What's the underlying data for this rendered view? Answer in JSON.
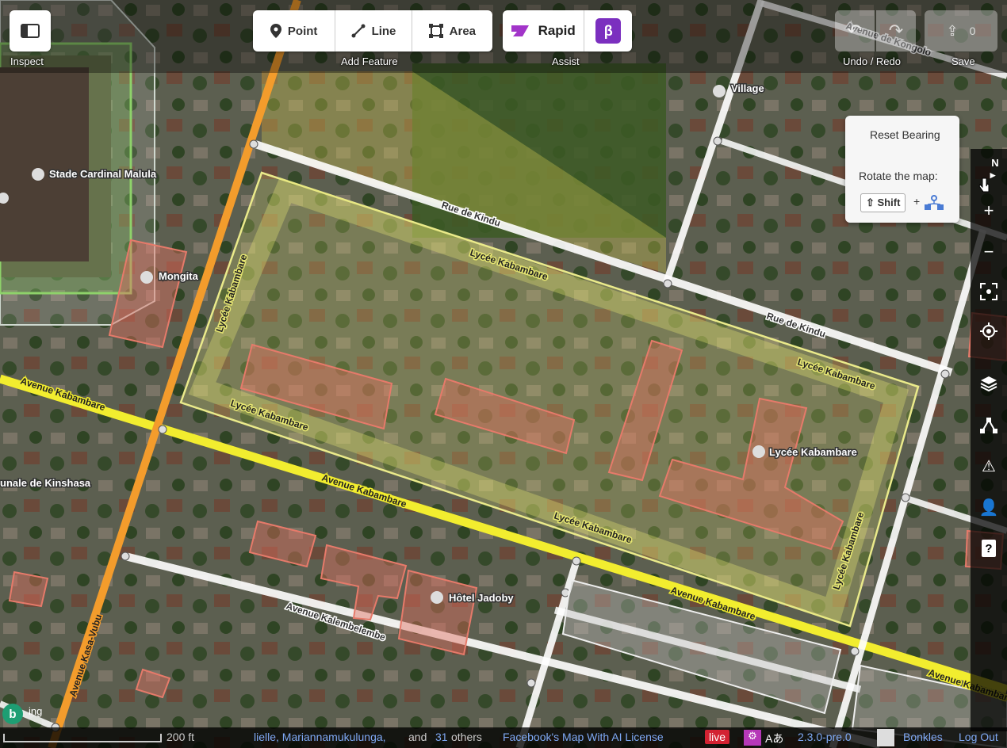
{
  "toolbar": {
    "inspect_label": "Inspect",
    "point_label": "Point",
    "line_label": "Line",
    "area_label": "Area",
    "add_feature_label": "Add Feature",
    "rapid_label": "Rapid",
    "beta_label": "β",
    "assist_label": "Assist",
    "undo_redo_label": "Undo / Redo",
    "save_label": "Save",
    "save_count": "0"
  },
  "map_labels": {
    "stade": "Stade Cardinal Malula",
    "mongita": "Mongita",
    "village": "Village",
    "rue_kindu_1": "Rue de Kindu",
    "rue_kindu_2": "Rue de Kindu",
    "lycee_area_1": "Lycée Kabambare",
    "lycee_area_2": "Lycée Kabambare",
    "lycee_area_3": "Lycée Kabambare",
    "lycee_area_4": "Lycée Kabambare",
    "lycee_area_5": "Lycée Kabambare",
    "lycee_area_6": "Lycée Kabambare",
    "lycee_poi": "Lycée Kabambare",
    "ave_kabambare_1": "Avenue Kabambare",
    "ave_kabambare_2": "Avenue Kabambare",
    "ave_kabambare_3": "Avenue Kabambare",
    "ave_kabambare_4": "Avenue Kabambare",
    "ave_kalembelembe": "Avenue Kalembelembe",
    "ave_kasa_vubu": "Avenue Kasa-Vubu",
    "hotel": "Hôtel Jadoby",
    "tribunal": "unale de Kinshasa",
    "ave_kongolo": "Avenue de Kongolo"
  },
  "popover": {
    "reset_bearing": "Reset Bearing",
    "rotate_label": "Rotate the map:",
    "shift_key": "Shift",
    "plus": "+"
  },
  "map_controls": {
    "north": "N",
    "zoom_in": "+",
    "zoom_out": "−"
  },
  "footer": {
    "bing_text": "ing",
    "scale": "200 ft",
    "contributors": "lielle, Mariannamukulunga,",
    "and_text": "and",
    "others_count": "31",
    "others_text": "others",
    "license": "Facebook's Map With AI License",
    "live": "live",
    "lang": "Aあ",
    "version": "2.3.0-pre.0",
    "user": "Bonkles",
    "logout": "Log Out"
  },
  "colors": {
    "primary_road": "#f39c2c",
    "secondary_road": "#f2ed2f",
    "building": "#e06e5f",
    "school_area": "#e5e572",
    "live_badge": "#d32232",
    "rapid_beta": "#7b2fbf"
  }
}
